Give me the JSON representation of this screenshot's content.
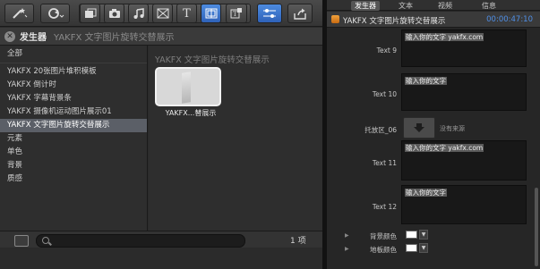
{
  "browser": {
    "header_title": "发生器",
    "header_subtitle": "YAKFX 文字图片旋转交替展示",
    "sidebar_items": [
      {
        "label": "全部",
        "selected": false
      },
      {
        "label": "YAKFX 20张图片堆积模板",
        "selected": false
      },
      {
        "label": "YAKFX 倒计时",
        "selected": false
      },
      {
        "label": "YAKFX 字幕背景条",
        "selected": false
      },
      {
        "label": "YAKFX 摄像机运动图片展示01",
        "selected": false
      },
      {
        "label": "YAKFX 文字图片旋转交替展示",
        "selected": true
      },
      {
        "label": "元素",
        "selected": false
      },
      {
        "label": "单色",
        "selected": false
      },
      {
        "label": "背景",
        "selected": false
      },
      {
        "label": "质感",
        "selected": false
      }
    ],
    "content_title": "YAKFX 文字图片旋转交替展示",
    "thumbnail_label": "YAKFX...替展示",
    "item_count": "1 项"
  },
  "toolbar": {
    "icons": [
      "magic-wand-icon",
      "undo-icon",
      "browser-icon",
      "camera-icon",
      "music-icon",
      "transition-icon",
      "title-icon",
      "generator-icon",
      "themes-icon",
      "inspector-toggle-icon",
      "share-icon"
    ]
  },
  "inspector": {
    "tabs": [
      "发生器",
      "文本",
      "视频",
      "信息"
    ],
    "active_tab": "发生器",
    "title": "YAKFX 文字图片旋转交替展示",
    "timecode": "00:00:47:10",
    "fields": [
      {
        "label": "Text 9",
        "value": "输入你的文字 yakfx.com"
      },
      {
        "label": "Text 10",
        "value": "输入你的文字"
      },
      {
        "label": "Text 11",
        "value": "输入你的文字 yakfx.com"
      },
      {
        "label": "Text 12",
        "value": "输入你的文字"
      }
    ],
    "drop_zone": {
      "label": "托放区_06",
      "placeholder": "没有来源"
    },
    "colors": [
      {
        "label": "背景颜色",
        "value": "#ffffff"
      },
      {
        "label": "地板颜色",
        "value": "#ffffff"
      }
    ]
  },
  "colors": {
    "accent": "#4f8fe6",
    "selected_row": "#5b5f67",
    "title_icon": "#e08a2a"
  }
}
